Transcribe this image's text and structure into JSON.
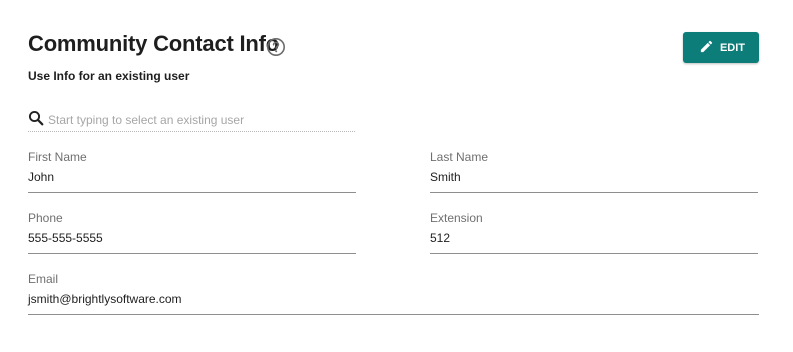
{
  "header": {
    "title": "Community Contact Info",
    "subtitle": "Use Info for an existing user",
    "help_icon": "help-circle-icon",
    "edit_label": "EDIT",
    "edit_icon": "pencil-icon",
    "accent_color": "#0d7d7a"
  },
  "search": {
    "icon": "search-icon",
    "placeholder": "Start typing to select an existing user",
    "value": ""
  },
  "fields": {
    "first_name": {
      "label": "First Name",
      "value": "John"
    },
    "last_name": {
      "label": "Last Name",
      "value": "Smith"
    },
    "phone": {
      "label": "Phone",
      "value": "555-555-5555"
    },
    "extension": {
      "label": "Extension",
      "value": "512"
    },
    "email": {
      "label": "Email",
      "value": "jsmith@brightlysoftware.com"
    }
  }
}
